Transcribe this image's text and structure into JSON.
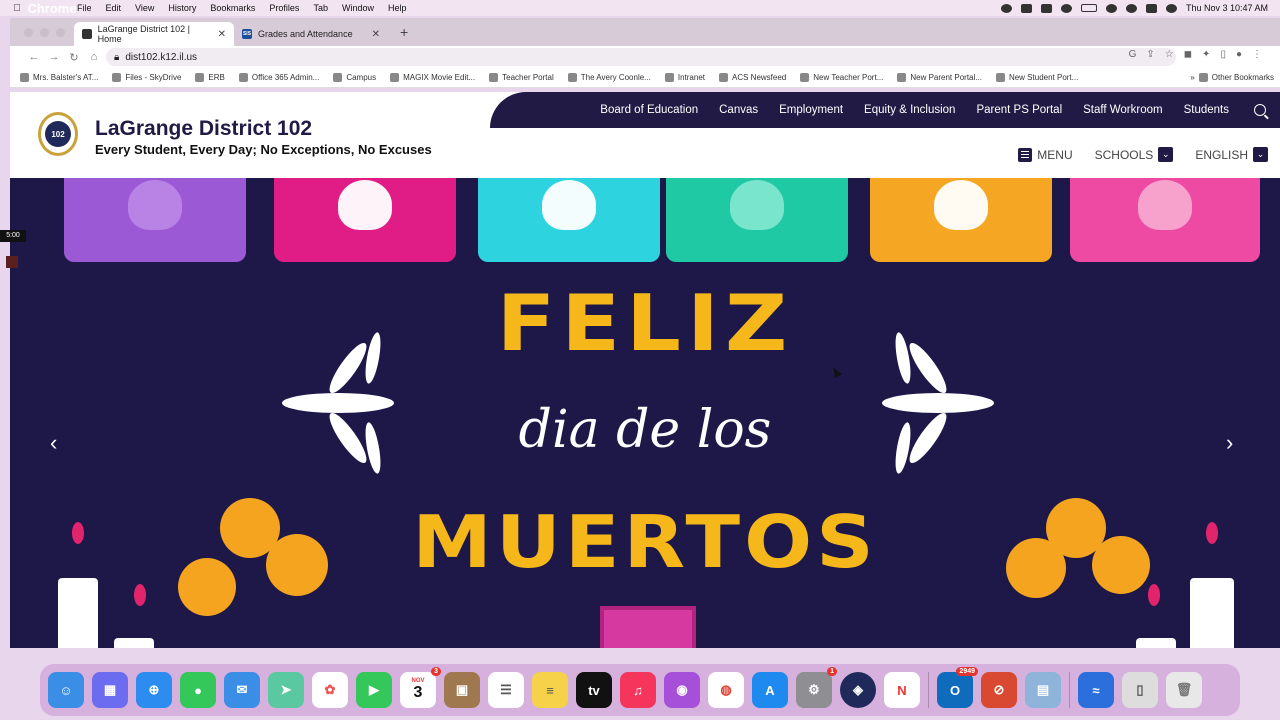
{
  "macbar": {
    "app": "Chrome",
    "menus": [
      "File",
      "Edit",
      "View",
      "History",
      "Bookmarks",
      "Profiles",
      "Tab",
      "Window",
      "Help"
    ],
    "clock": "Thu Nov 3  10:47 AM"
  },
  "browser": {
    "tabs": [
      {
        "title": "LaGrange District 102 | Home"
      },
      {
        "title": "Grades and Attendance",
        "favicon": "SIS"
      }
    ],
    "url": "dist102.k12.il.us",
    "bookmarks": [
      "Mrs. Balster's AT...",
      "Files - SkyDrive",
      "ERB",
      "Office 365 Admin...",
      "Campus",
      "MAGIX Movie Edit...",
      "Teacher Portal",
      "The Avery Coonle...",
      "Intranet",
      "ACS Newsfeed",
      "New Teacher Port...",
      "New Parent Portal...",
      "New Student Port..."
    ],
    "other_bookmarks": "Other Bookmarks",
    "overflow": "»"
  },
  "site": {
    "logo_text": "102",
    "title": "LaGrange District 102",
    "tagline": "Every Student, Every Day; No Exceptions, No Excuses",
    "topnav": [
      "Board of Education",
      "Canvas",
      "Employment",
      "Equity & Inclusion",
      "Parent PS Portal",
      "Staff Workroom",
      "Students"
    ],
    "menu_label": "MENU",
    "schools_label": "SCHOOLS",
    "language_label": "ENGLISH"
  },
  "hero": {
    "line1": "FELIZ",
    "line2": "dia de los",
    "line3": "MUERTOS",
    "prev": "‹",
    "next": "›"
  },
  "side_widget": {
    "timer": "5:00"
  },
  "dock": {
    "calendar_month": "NOV",
    "calendar_day": "3",
    "calendar_badge": "3",
    "settings_badge": "1",
    "outlook_badge": "2949"
  },
  "colors": {
    "navy": "#201a45",
    "gold": "#f6b71a",
    "hero_bg": "#1e1848"
  }
}
